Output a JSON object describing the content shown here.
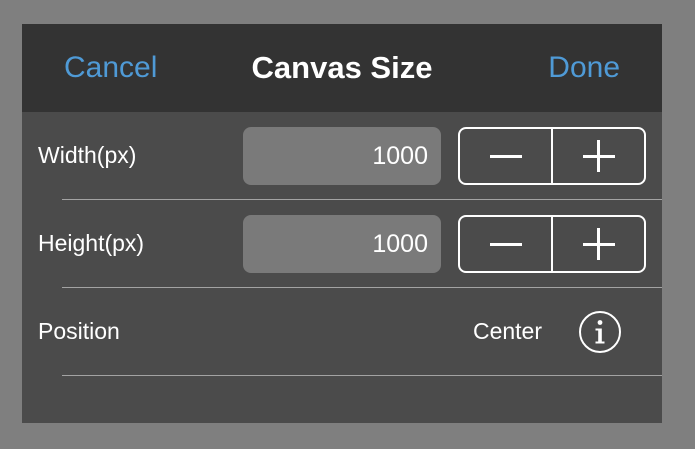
{
  "header": {
    "cancel_label": "Cancel",
    "title": "Canvas Size",
    "done_label": "Done"
  },
  "rows": [
    {
      "label": "Width(px)",
      "value": "1000"
    },
    {
      "label": "Height(px)",
      "value": "1000"
    },
    {
      "label": "Position",
      "value": "Center",
      "icon": "info-icon"
    }
  ],
  "colors": {
    "accent": "#4f9ad6",
    "header_bg": "#333333",
    "panel_bg": "#4b4b4b",
    "field_bg": "#7a7a7a",
    "backdrop": "#7f7f7f"
  }
}
